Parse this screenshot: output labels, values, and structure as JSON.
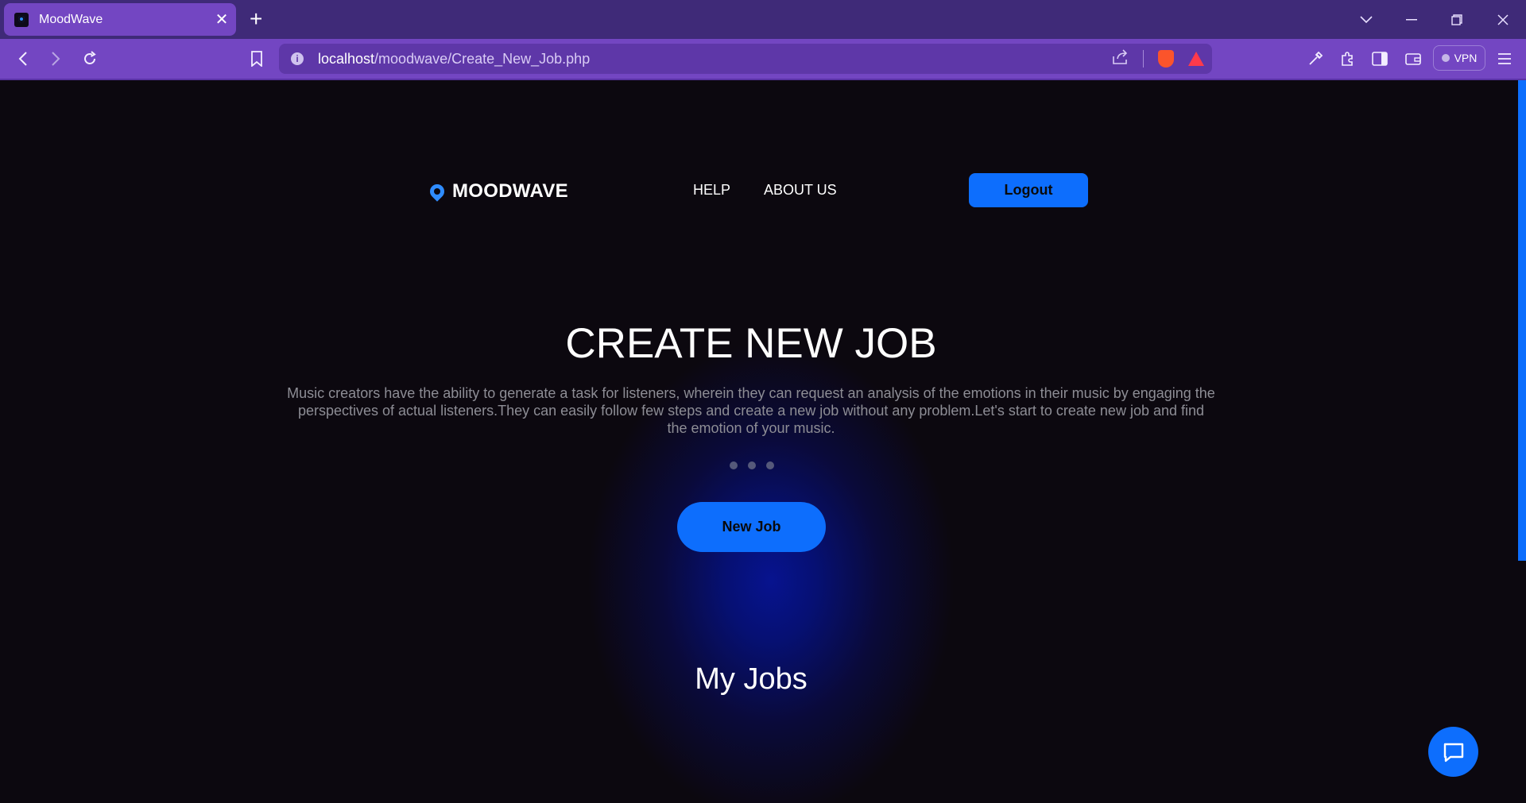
{
  "browser": {
    "tab_title": "MoodWave",
    "tab_close": "✕",
    "new_tab": "+",
    "url_host": "localhost",
    "url_path": "/moodwave/Create_New_Job.php",
    "vpn_label": "VPN"
  },
  "nav": {
    "brand": "MOODWAVE",
    "links": [
      "HELP",
      "ABOUT US"
    ],
    "logout_label": "Logout"
  },
  "hero": {
    "title": "CREATE NEW JOB",
    "description": "Music creators have the ability to generate a task for listeners, wherein they can request an analysis of the emotions in their music by engaging the perspectives of actual listeners.They can easily follow few steps and create a new job without any problem.Let's start to create new job and find the emotion of your music.",
    "button_label": "New Job"
  },
  "section": {
    "my_jobs_title": "My Jobs"
  },
  "colors": {
    "accent": "#0d6efd",
    "browser_frame": "#7346c2",
    "page_bg": "#0c080f"
  },
  "icons": [
    "search-icon",
    "chat-icon"
  ]
}
